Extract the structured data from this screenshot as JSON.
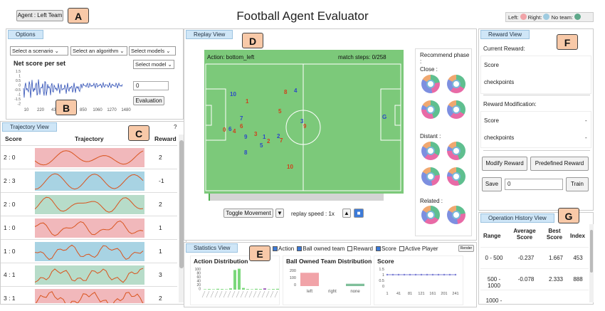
{
  "header": {
    "agent_label": "Agent : Left Team",
    "title": "Football Agent Evaluator",
    "legend_left": "Left:",
    "legend_right": "Right:",
    "legend_noteam": "No team:",
    "colors": {
      "left": "#f1a3a8",
      "right": "#9ecbe0",
      "noteam": "#5fa88a"
    }
  },
  "callouts": [
    "A",
    "B",
    "C",
    "D",
    "E",
    "F",
    "G"
  ],
  "options": {
    "tab": "Options",
    "scenario": "Select a scenario",
    "algorithm": "Select an algorithm",
    "models": "Select models",
    "model": "Select model",
    "chart_title": "Net score per set",
    "input_value": "0",
    "eval_button": "Evaluation",
    "y_ticks": [
      "1.5",
      "1",
      "0.5",
      "0",
      "-0.5",
      "-1",
      "-1.5",
      "-2"
    ],
    "x_ticks": [
      "10",
      "220",
      "430",
      "640",
      "850",
      "1060",
      "1270",
      "1480"
    ]
  },
  "trajectory": {
    "tab": "Trajectory View",
    "help": "?",
    "headers": {
      "score": "Score",
      "trajectory": "Trajectory",
      "reward": "Reward"
    },
    "rows": [
      {
        "score": "2 : 0",
        "reward": "2"
      },
      {
        "score": "2 : 3",
        "reward": "-1"
      },
      {
        "score": "2 : 0",
        "reward": "2"
      },
      {
        "score": "1 : 0",
        "reward": "1"
      },
      {
        "score": "1 : 0",
        "reward": "1"
      },
      {
        "score": "4 : 1",
        "reward": "3"
      },
      {
        "score": "3 : 1",
        "reward": "2"
      }
    ]
  },
  "replay": {
    "tab": "Replay View",
    "action": "Action: bottom_left",
    "steps": "match steps: 0/258",
    "toggle": "Toggle Movement",
    "speed": "replay speed : 1x",
    "recommend": "Recommend phase :",
    "close": "Close :",
    "distant": "Distant :",
    "related": "Related :",
    "goal": "G",
    "players": [
      {
        "n": "10",
        "team": "blue"
      },
      {
        "n": "1",
        "team": "red"
      },
      {
        "n": "8",
        "team": "red"
      },
      {
        "n": "4",
        "team": "blue"
      },
      {
        "n": "5",
        "team": "red"
      },
      {
        "n": "7",
        "team": "blue"
      },
      {
        "n": "3",
        "team": "blue"
      },
      {
        "n": "9",
        "team": "red"
      },
      {
        "n": "0",
        "team": "red"
      },
      {
        "n": "6",
        "team": "blue"
      },
      {
        "n": "4",
        "team": "red"
      },
      {
        "n": "6",
        "team": "red"
      },
      {
        "n": "3",
        "team": "red"
      },
      {
        "n": "9",
        "team": "blue"
      },
      {
        "n": "1",
        "team": "blue"
      },
      {
        "n": "2",
        "team": "red"
      },
      {
        "n": "7",
        "team": "red"
      },
      {
        "n": "2",
        "team": "blue"
      },
      {
        "n": "5",
        "team": "blue"
      },
      {
        "n": "8",
        "team": "blue"
      },
      {
        "n": "10",
        "team": "red"
      }
    ]
  },
  "statistics": {
    "tab": "Statistics View",
    "checks": [
      {
        "label": "Action",
        "checked": true
      },
      {
        "label": "Ball owned team",
        "checked": true
      },
      {
        "label": "Reward",
        "checked": false
      },
      {
        "label": "Score",
        "checked": true
      },
      {
        "label": "Active Player",
        "checked": false
      }
    ],
    "render_button": "Render",
    "action_title": "Action Distribution",
    "action_y_ticks": [
      "100",
      "80",
      "60",
      "40",
      "20",
      "0"
    ],
    "ball_title": "Ball Owned Team Distribution",
    "ball_y_ticks": [
      "200",
      "100",
      "0"
    ],
    "ball_categories": [
      "left",
      "right",
      "none"
    ],
    "score_title": "Score",
    "score_y_ticks": [
      "1.5",
      "1",
      "0.5",
      "0"
    ],
    "score_x_ticks": [
      "1",
      "41",
      "81",
      "121",
      "161",
      "201",
      "241"
    ]
  },
  "reward": {
    "tab": "Reward View",
    "current": "Current Reward:",
    "cur_items": [
      "Score",
      "checkpoints"
    ],
    "modification": "Reward Modification:",
    "mod_items": [
      "Score",
      "checkpoints"
    ],
    "modify_button": "Modify Reward",
    "predefined_button": "Predefined Reward",
    "save_button": "Save",
    "save_value": "0",
    "train_button": "Train"
  },
  "history": {
    "tab": "Operation History View",
    "headers": {
      "range": "Range",
      "avg": "Average Score",
      "best": "Best Score",
      "index": "Index"
    },
    "rows": [
      {
        "range": "0 - 500",
        "avg": "-0.237",
        "best": "1.667",
        "index": "453"
      },
      {
        "range": "500 - 1000",
        "avg": "-0.078",
        "best": "2.333",
        "index": "888"
      },
      {
        "range": "1000 -",
        "avg": "",
        "best": "",
        "index": ""
      }
    ]
  }
}
